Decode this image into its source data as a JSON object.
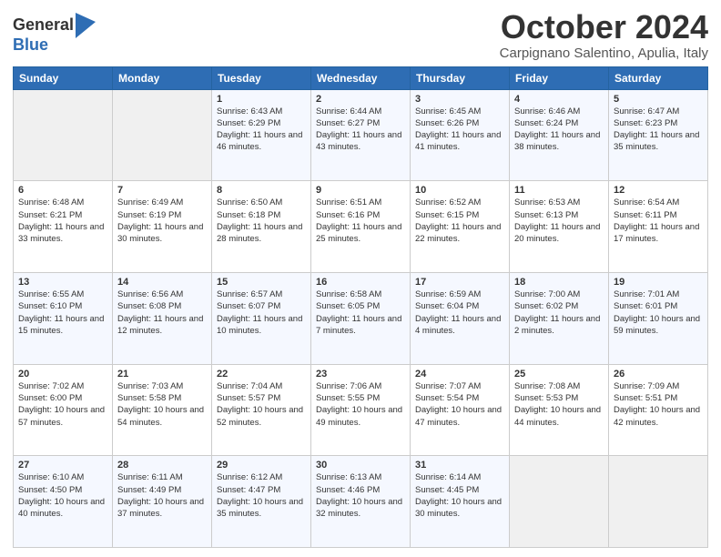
{
  "header": {
    "logo_general": "General",
    "logo_blue": "Blue",
    "month_title": "October 2024",
    "location": "Carpignano Salentino, Apulia, Italy"
  },
  "weekdays": [
    "Sunday",
    "Monday",
    "Tuesday",
    "Wednesday",
    "Thursday",
    "Friday",
    "Saturday"
  ],
  "weeks": [
    [
      {
        "day": "",
        "info": ""
      },
      {
        "day": "",
        "info": ""
      },
      {
        "day": "1",
        "info": "Sunrise: 6:43 AM\nSunset: 6:29 PM\nDaylight: 11 hours and 46 minutes."
      },
      {
        "day": "2",
        "info": "Sunrise: 6:44 AM\nSunset: 6:27 PM\nDaylight: 11 hours and 43 minutes."
      },
      {
        "day": "3",
        "info": "Sunrise: 6:45 AM\nSunset: 6:26 PM\nDaylight: 11 hours and 41 minutes."
      },
      {
        "day": "4",
        "info": "Sunrise: 6:46 AM\nSunset: 6:24 PM\nDaylight: 11 hours and 38 minutes."
      },
      {
        "day": "5",
        "info": "Sunrise: 6:47 AM\nSunset: 6:23 PM\nDaylight: 11 hours and 35 minutes."
      }
    ],
    [
      {
        "day": "6",
        "info": "Sunrise: 6:48 AM\nSunset: 6:21 PM\nDaylight: 11 hours and 33 minutes."
      },
      {
        "day": "7",
        "info": "Sunrise: 6:49 AM\nSunset: 6:19 PM\nDaylight: 11 hours and 30 minutes."
      },
      {
        "day": "8",
        "info": "Sunrise: 6:50 AM\nSunset: 6:18 PM\nDaylight: 11 hours and 28 minutes."
      },
      {
        "day": "9",
        "info": "Sunrise: 6:51 AM\nSunset: 6:16 PM\nDaylight: 11 hours and 25 minutes."
      },
      {
        "day": "10",
        "info": "Sunrise: 6:52 AM\nSunset: 6:15 PM\nDaylight: 11 hours and 22 minutes."
      },
      {
        "day": "11",
        "info": "Sunrise: 6:53 AM\nSunset: 6:13 PM\nDaylight: 11 hours and 20 minutes."
      },
      {
        "day": "12",
        "info": "Sunrise: 6:54 AM\nSunset: 6:11 PM\nDaylight: 11 hours and 17 minutes."
      }
    ],
    [
      {
        "day": "13",
        "info": "Sunrise: 6:55 AM\nSunset: 6:10 PM\nDaylight: 11 hours and 15 minutes."
      },
      {
        "day": "14",
        "info": "Sunrise: 6:56 AM\nSunset: 6:08 PM\nDaylight: 11 hours and 12 minutes."
      },
      {
        "day": "15",
        "info": "Sunrise: 6:57 AM\nSunset: 6:07 PM\nDaylight: 11 hours and 10 minutes."
      },
      {
        "day": "16",
        "info": "Sunrise: 6:58 AM\nSunset: 6:05 PM\nDaylight: 11 hours and 7 minutes."
      },
      {
        "day": "17",
        "info": "Sunrise: 6:59 AM\nSunset: 6:04 PM\nDaylight: 11 hours and 4 minutes."
      },
      {
        "day": "18",
        "info": "Sunrise: 7:00 AM\nSunset: 6:02 PM\nDaylight: 11 hours and 2 minutes."
      },
      {
        "day": "19",
        "info": "Sunrise: 7:01 AM\nSunset: 6:01 PM\nDaylight: 10 hours and 59 minutes."
      }
    ],
    [
      {
        "day": "20",
        "info": "Sunrise: 7:02 AM\nSunset: 6:00 PM\nDaylight: 10 hours and 57 minutes."
      },
      {
        "day": "21",
        "info": "Sunrise: 7:03 AM\nSunset: 5:58 PM\nDaylight: 10 hours and 54 minutes."
      },
      {
        "day": "22",
        "info": "Sunrise: 7:04 AM\nSunset: 5:57 PM\nDaylight: 10 hours and 52 minutes."
      },
      {
        "day": "23",
        "info": "Sunrise: 7:06 AM\nSunset: 5:55 PM\nDaylight: 10 hours and 49 minutes."
      },
      {
        "day": "24",
        "info": "Sunrise: 7:07 AM\nSunset: 5:54 PM\nDaylight: 10 hours and 47 minutes."
      },
      {
        "day": "25",
        "info": "Sunrise: 7:08 AM\nSunset: 5:53 PM\nDaylight: 10 hours and 44 minutes."
      },
      {
        "day": "26",
        "info": "Sunrise: 7:09 AM\nSunset: 5:51 PM\nDaylight: 10 hours and 42 minutes."
      }
    ],
    [
      {
        "day": "27",
        "info": "Sunrise: 6:10 AM\nSunset: 4:50 PM\nDaylight: 10 hours and 40 minutes."
      },
      {
        "day": "28",
        "info": "Sunrise: 6:11 AM\nSunset: 4:49 PM\nDaylight: 10 hours and 37 minutes."
      },
      {
        "day": "29",
        "info": "Sunrise: 6:12 AM\nSunset: 4:47 PM\nDaylight: 10 hours and 35 minutes."
      },
      {
        "day": "30",
        "info": "Sunrise: 6:13 AM\nSunset: 4:46 PM\nDaylight: 10 hours and 32 minutes."
      },
      {
        "day": "31",
        "info": "Sunrise: 6:14 AM\nSunset: 4:45 PM\nDaylight: 10 hours and 30 minutes."
      },
      {
        "day": "",
        "info": ""
      },
      {
        "day": "",
        "info": ""
      }
    ]
  ]
}
